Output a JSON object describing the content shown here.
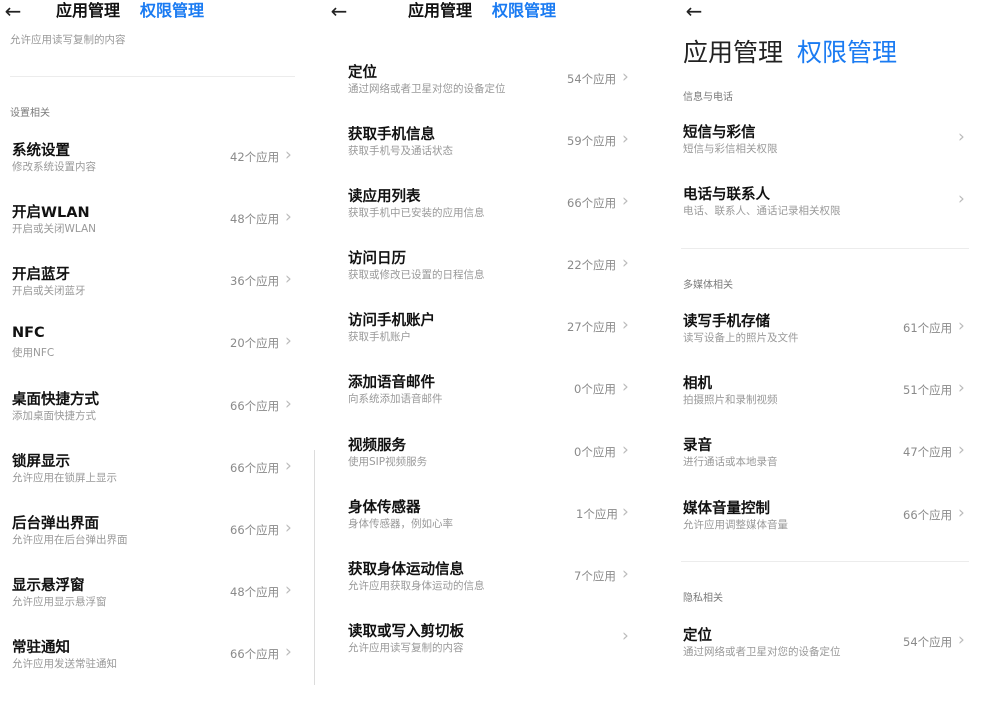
{
  "panel1": {
    "back": "←",
    "tab_app": "应用管理",
    "tab_perm": "权限管理",
    "cut_desc": "允许应用读写复制的内容",
    "section": "设置相关",
    "items": [
      {
        "title": "系统设置",
        "desc": "修改系统设置内容",
        "count": "42个应用"
      },
      {
        "title": "开启WLAN",
        "desc": "开启或关闭WLAN",
        "count": "48个应用"
      },
      {
        "title": "开启蓝牙",
        "desc": "开启或关闭蓝牙",
        "count": "36个应用"
      },
      {
        "title": "NFC",
        "desc": "使用NFC",
        "count": "20个应用"
      },
      {
        "title": "桌面快捷方式",
        "desc": "添加桌面快捷方式",
        "count": "66个应用"
      },
      {
        "title": "锁屏显示",
        "desc": "允许应用在锁屏上显示",
        "count": "66个应用"
      },
      {
        "title": "后台弹出界面",
        "desc": "允许应用在后台弹出界面",
        "count": "66个应用"
      },
      {
        "title": "显示悬浮窗",
        "desc": "允许应用显示悬浮窗",
        "count": "48个应用"
      },
      {
        "title": "常驻通知",
        "desc": "允许应用发送常驻通知",
        "count": "66个应用"
      }
    ]
  },
  "panel2": {
    "back": "←",
    "tab_app": "应用管理",
    "tab_perm": "权限管理",
    "items": [
      {
        "title": "定位",
        "desc": "通过网络或者卫星对您的设备定位",
        "count": "54个应用"
      },
      {
        "title": "获取手机信息",
        "desc": "获取手机号及通话状态",
        "count": "59个应用"
      },
      {
        "title": "读应用列表",
        "desc": "获取手机中已安装的应用信息",
        "count": "66个应用"
      },
      {
        "title": "访问日历",
        "desc": "获取或修改已设置的日程信息",
        "count": "22个应用"
      },
      {
        "title": "访问手机账户",
        "desc": "获取手机账户",
        "count": "27个应用"
      },
      {
        "title": "添加语音邮件",
        "desc": "向系统添加语音邮件",
        "count": "0个应用"
      },
      {
        "title": "视频服务",
        "desc": "使用SIP视频服务",
        "count": "0个应用"
      },
      {
        "title": "身体传感器",
        "desc": "身体传感器，例如心率",
        "count": "1个应用"
      },
      {
        "title": "获取身体运动信息",
        "desc": "允许应用获取身体运动的信息",
        "count": "7个应用"
      },
      {
        "title": "读取或写入剪切板",
        "desc": "允许应用读写复制的内容",
        "count": ""
      }
    ]
  },
  "panel3": {
    "back": "←",
    "title_app": "应用管理",
    "title_perm": "权限管理",
    "sections": {
      "s1": "信息与电话",
      "s2": "多媒体相关",
      "s3": "隐私相关"
    },
    "items_s1": [
      {
        "title": "短信与彩信",
        "desc": "短信与彩信相关权限",
        "count": ""
      },
      {
        "title": "电话与联系人",
        "desc": "电话、联系人、通话记录相关权限",
        "count": ""
      }
    ],
    "items_s2": [
      {
        "title": "读写手机存储",
        "desc": "读写设备上的照片及文件",
        "count": "61个应用"
      },
      {
        "title": "相机",
        "desc": "拍摄照片和录制视频",
        "count": "51个应用"
      },
      {
        "title": "录音",
        "desc": "进行通话或本地录音",
        "count": "47个应用"
      },
      {
        "title": "媒体音量控制",
        "desc": "允许应用调整媒体音量",
        "count": "66个应用"
      }
    ],
    "items_s3": [
      {
        "title": "定位",
        "desc": "通过网络或者卫星对您的设备定位",
        "count": "54个应用"
      }
    ]
  },
  "chevron": "›"
}
